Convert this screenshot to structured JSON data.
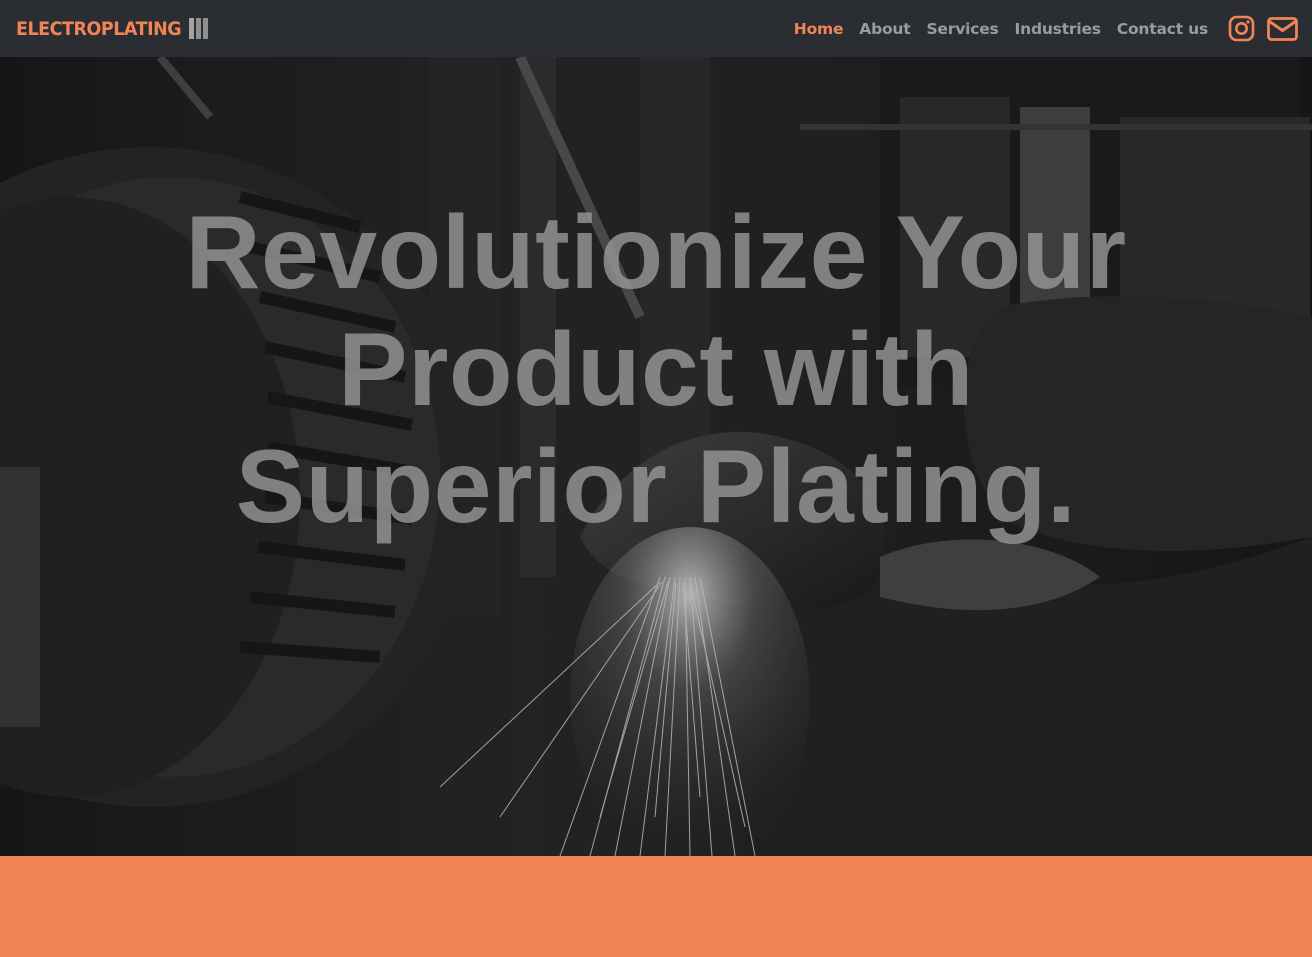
{
  "brand": {
    "name": "ELECTROPLATING",
    "accent_color": "#f08456"
  },
  "nav": {
    "items": [
      {
        "label": "Home",
        "active": true
      },
      {
        "label": "About",
        "active": false
      },
      {
        "label": "Services",
        "active": false
      },
      {
        "label": "Industries",
        "active": false
      },
      {
        "label": "Contact us",
        "active": false
      }
    ],
    "social": [
      {
        "icon": "instagram-icon"
      },
      {
        "icon": "envelope-icon"
      }
    ]
  },
  "hero": {
    "headline_lines": [
      "Revolutionize Your",
      "Product with",
      "Superior Plating."
    ],
    "background": "grayscale-photo-grinding-sparks"
  },
  "colors": {
    "navbar": "#2a2e33",
    "accent": "#f08456",
    "nav_inactive": "#9b9b9b"
  }
}
